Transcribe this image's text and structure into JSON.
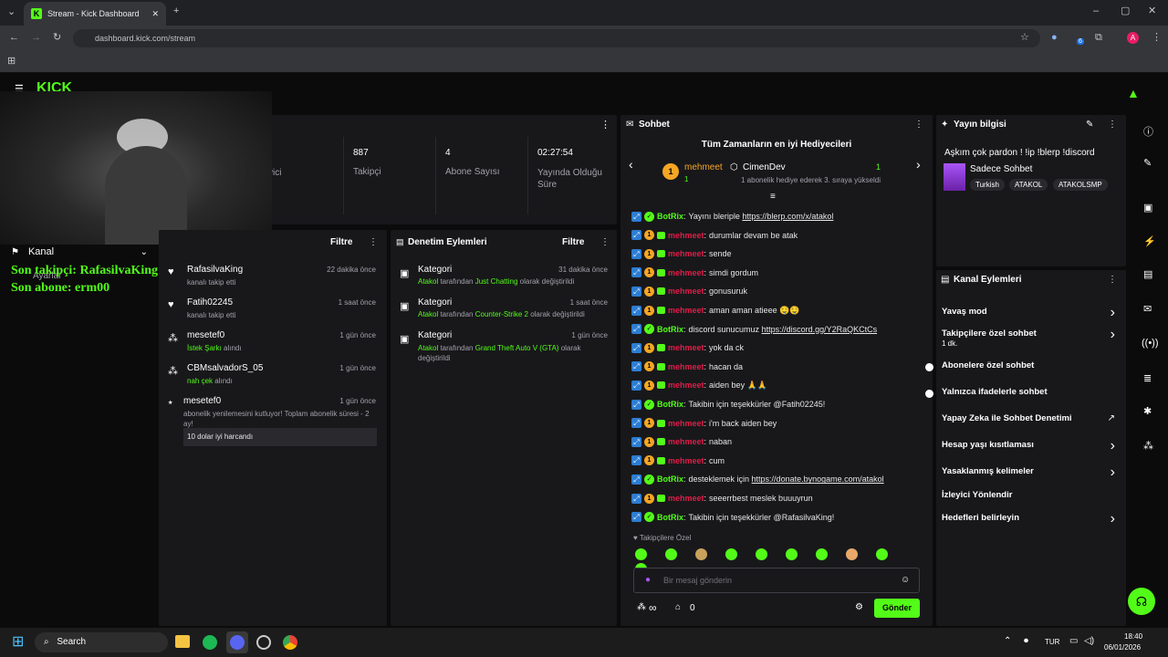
{
  "browser": {
    "tab_title": "Stream - Kick Dashboard",
    "url": "dashboard.kick.com/stream",
    "profile_initial": "A",
    "ext_badge": "6"
  },
  "overlay": {
    "channel_label": "Kanal",
    "settings_label": "Ayarlar",
    "last_follower": "Son takipçi: RafasilvaKing",
    "last_sub": "Son abone: erm00"
  },
  "stats": {
    "partial_label": "yici",
    "items": [
      {
        "value": "887",
        "label": "Takipçi"
      },
      {
        "value": "4",
        "label": "Abone Sayısı"
      },
      {
        "value": "02:27:54",
        "label": "Yayında Olduğu Süre"
      }
    ]
  },
  "activity": {
    "filter": "Filtre",
    "items": [
      {
        "name": "RafasilvaKing",
        "time": "22 dakika önce",
        "desc": "kanalı takip etti"
      },
      {
        "name": "Fatih02245",
        "time": "1 saat önce",
        "desc": "kanalı takip etti"
      },
      {
        "name": "mesetef0",
        "time": "1 gün önce",
        "hl": "İstek Şarkı",
        "desc": " alındı"
      },
      {
        "name": "CBMsalvadorS_05",
        "time": "1 gün önce",
        "hl": "nah çek",
        "desc": " alındı"
      },
      {
        "name": "mesetef0",
        "time": "1 gün önce",
        "desc": "abonelik yenilemesini kutluyor! Toplam abonelik süresi - 2 ay!",
        "msg": "10 dolar iyi harcandı"
      }
    ]
  },
  "moderation": {
    "title": "Denetim Eylemleri",
    "filter": "Filtre",
    "items": [
      {
        "title": "Kategori",
        "time": "31 dakika önce",
        "by": "Atakol",
        "mid": " tarafından ",
        "cat": "Just Chatting",
        "end": " olarak değiştirildi"
      },
      {
        "title": "Kategori",
        "time": "1 saat önce",
        "by": "Atakol",
        "mid": " tarafından ",
        "cat": "Counter-Strike 2",
        "end": " olarak değiştirildi"
      },
      {
        "title": "Kategori",
        "time": "1 gün önce",
        "by": "Atakol",
        "mid": " tarafından ",
        "cat": "Grand Theft Auto V (GTA)",
        "end": " olarak değiştirildi"
      }
    ]
  },
  "chat": {
    "title": "Sohbet",
    "gifters_title": "Tüm Zamanların en iyi Hediyecileri",
    "gifter1": {
      "name": "mehmeet",
      "count": "1"
    },
    "gifter2": {
      "name": "CimenDev",
      "count": "1",
      "note": "1 abonelik hediye ederek 3. sıraya yükseldi"
    },
    "messages": [
      {
        "user": "BotRix",
        "bot": true,
        "text": "Yayını bleriple ",
        "link": "https://blerp.com/x/atakol"
      },
      {
        "user": "mehmeet",
        "text": "durumlar devam be atak"
      },
      {
        "user": "mehmeet",
        "text": "sende"
      },
      {
        "user": "mehmeet",
        "text": "simdi gordum"
      },
      {
        "user": "mehmeet",
        "text": "gonusuruk"
      },
      {
        "user": "mehmeet",
        "text": "aman aman atieee 🤤🤤"
      },
      {
        "user": "BotRix",
        "bot": true,
        "text": "discord sunucumuz ",
        "link": "https://discord.gg/Y2RaQKCtCs"
      },
      {
        "user": "mehmeet",
        "text": "yok da ck"
      },
      {
        "user": "mehmeet",
        "text": "hacan da"
      },
      {
        "user": "mehmeet",
        "text": "aiden bey 🙏🙏"
      },
      {
        "user": "BotRix",
        "bot": true,
        "text": "Takibin için teşekkürler @Fatih02245!"
      },
      {
        "user": "mehmeet",
        "text": "i'm back aiden bey"
      },
      {
        "user": "mehmeet",
        "text": "naban"
      },
      {
        "user": "mehmeet",
        "text": "cum"
      },
      {
        "user": "BotRix",
        "bot": true,
        "text": "desteklemek için ",
        "link": "https://donate.bynogame.com/atakol"
      },
      {
        "user": "mehmeet",
        "text": "seeerrbest meslek buuuyrun"
      },
      {
        "user": "BotRix",
        "bot": true,
        "text": "Takibin için teşekkürler @RafasilvaKing!"
      }
    ],
    "followers_only": "Takipçilere Özel",
    "input_placeholder": "Bir mesaj gönderin",
    "points": "∞",
    "store_count": "0",
    "send": "Gönder"
  },
  "stream_info": {
    "title": "Yayın bilgisi",
    "stream_title": "Aşkım çok pardon ! !ip !blerp !discord",
    "category": "Sadece Sohbet",
    "tags": [
      "Turkish",
      "ATAKOL",
      "ATAKOLSMP"
    ]
  },
  "channel_actions": {
    "title": "Kanal Eylemleri",
    "items": [
      {
        "label": "Yavaş mod",
        "kind": "caret"
      },
      {
        "label": "Takipçilere özel sohbet",
        "sub": "1 dk.",
        "kind": "caret"
      },
      {
        "label": "Abonelere özel sohbet",
        "kind": "toggle"
      },
      {
        "label": "Yalnızca ifadelerle sohbet",
        "kind": "toggle"
      },
      {
        "label": "Yapay Zeka ile Sohbet Denetimi",
        "kind": "ext"
      },
      {
        "label": "Hesap yaşı kısıtlaması",
        "kind": "caret"
      },
      {
        "label": "Yasaklanmış kelimeler",
        "kind": "caret"
      },
      {
        "label": "İzleyici Yönlendir",
        "kind": "none"
      },
      {
        "label": "Hedefleri belirleyin",
        "kind": "caret"
      }
    ]
  },
  "taskbar": {
    "search": "Search",
    "lang": "TUR",
    "time": "18:40",
    "date": "06/01/2026"
  },
  "colors": {
    "accent": "#53fc18",
    "panel": "#18181b",
    "bg": "#0b0b0c",
    "username": "#e11d48"
  }
}
